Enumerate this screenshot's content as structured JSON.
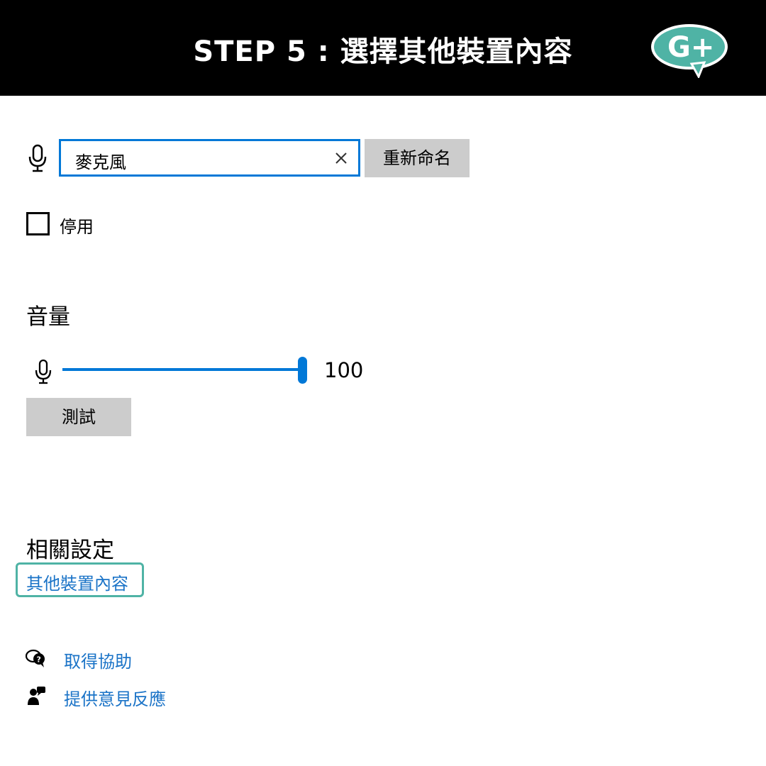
{
  "banner": {
    "title": "STEP 5 : 選擇其他裝置內容",
    "logo_text": "G+",
    "logo_color": "#4fb3a5"
  },
  "device": {
    "icon": "microphone-icon",
    "name_value": "麥克風",
    "clear_icon": "close-icon",
    "rename_label": "重新命名",
    "disable_label": "停用",
    "disable_checked": false
  },
  "volume": {
    "title": "音量",
    "icon": "microphone-icon",
    "value": "100",
    "level_percent": 100,
    "test_label": "測試",
    "accent": "#0078d7"
  },
  "related": {
    "title": "相關設定",
    "other_device_link": "其他裝置內容",
    "highlight_color": "#4fb3a5"
  },
  "support": {
    "help_icon": "help-chat-icon",
    "help_link": "取得協助",
    "feedback_icon": "feedback-icon",
    "feedback_link": "提供意見反應",
    "link_color": "#1a73c7"
  }
}
